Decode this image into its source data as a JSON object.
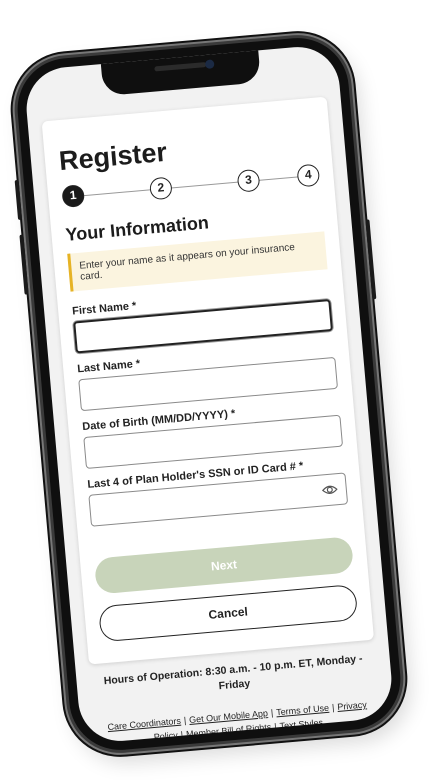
{
  "register": {
    "title": "Register",
    "steps": [
      "1",
      "2",
      "3",
      "4"
    ],
    "current_step": 1
  },
  "section": {
    "title": "Your Information",
    "notice": "Enter your name as it appears on your insurance card."
  },
  "fields": {
    "first_name": {
      "label": "First Name *",
      "value": ""
    },
    "last_name": {
      "label": "Last Name *",
      "value": ""
    },
    "dob": {
      "label": "Date of Birth (MM/DD/YYYY) *",
      "value": ""
    },
    "ssn": {
      "label": "Last 4 of Plan Holder's SSN or ID Card # *",
      "value": "",
      "icon": "eye-icon"
    }
  },
  "buttons": {
    "next": "Next",
    "cancel": "Cancel"
  },
  "footer": {
    "hours": "Hours of Operation: 8:30 a.m. - 10 p.m. ET, Monday - Friday",
    "links": [
      "Care Coordinators",
      "Get Our Mobile App",
      "Terms of Use",
      "Privacy Policy",
      "Member Bill of Rights",
      "Text Styles"
    ]
  },
  "colors": {
    "next_button_disabled": "#c8d4ba",
    "notice_bg": "#fbf4df",
    "notice_accent": "#e6b325"
  }
}
